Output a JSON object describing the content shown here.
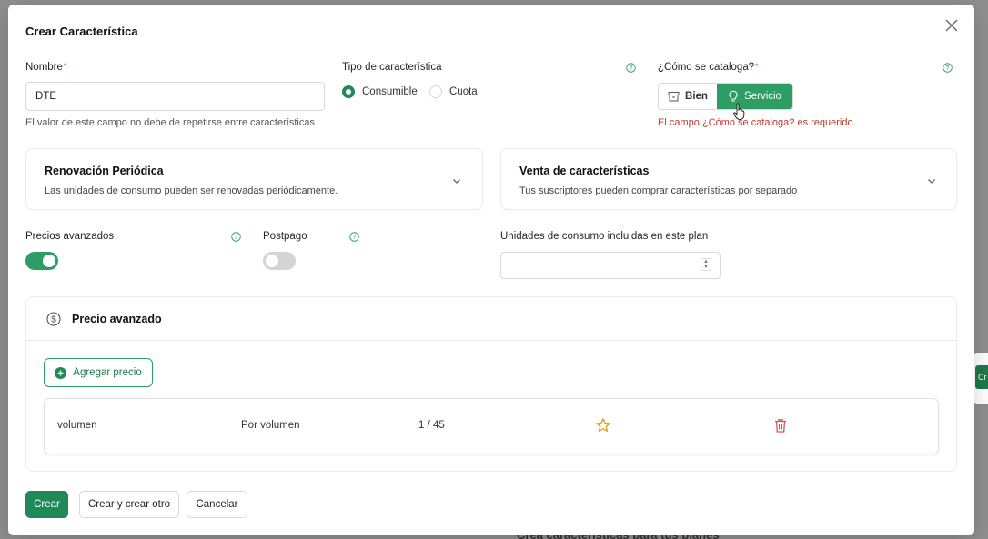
{
  "modal": {
    "title": "Crear Característica"
  },
  "nombre": {
    "label": "Nombre",
    "required_mark": "*",
    "value": "DTE",
    "hint": "El valor de este campo no debe de repetirse entre características"
  },
  "tipo": {
    "label": "Tipo de característica",
    "options": [
      {
        "label": "Consumible",
        "selected": true
      },
      {
        "label": "Cuota",
        "selected": false
      }
    ]
  },
  "catalogo": {
    "label": "¿Cómo se cataloga?",
    "required_mark": "*",
    "options": [
      {
        "label": "Bien",
        "selected": false,
        "icon": "archive-box-icon"
      },
      {
        "label": "Servicio",
        "selected": true,
        "icon": "lightbulb-icon"
      }
    ],
    "error": "El campo ¿Cómo se cataloga? es requerido."
  },
  "cards": [
    {
      "title": "Renovación Periódica",
      "subtitle": "Las unidades de consumo pueden ser renovadas periódicamente."
    },
    {
      "title": "Venta de características",
      "subtitle": "Tus suscriptores pueden comprar características por separado"
    }
  ],
  "toggles": {
    "precios_avanzados": {
      "label": "Precios avanzados",
      "on": true
    },
    "postpago": {
      "label": "Postpago",
      "on": false
    }
  },
  "unidades": {
    "label": "Unidades de consumo incluidas en este plan",
    "value": ""
  },
  "precio_avanzado": {
    "title": "Precio avanzado",
    "icon": "dollar-circle-icon",
    "add_label": "Agregar precio",
    "rows": [
      {
        "name": "volumen",
        "type": "Por volumen",
        "range": "1 / 45"
      }
    ]
  },
  "footer": {
    "crear": "Crear",
    "crear_otro": "Crear y crear otro",
    "cancelar": "Cancelar"
  },
  "background": {
    "peek_button": "Cr",
    "peek_heading": "Crea características para tus planes"
  },
  "colors": {
    "primary": "#1e8a55",
    "error": "#c0392b",
    "star": "#e0a020",
    "trash": "#d9534f"
  }
}
